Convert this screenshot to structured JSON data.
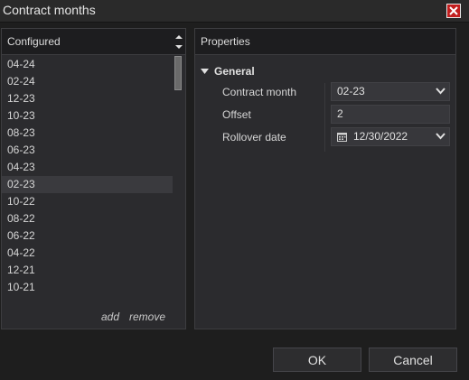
{
  "window": {
    "title": "Contract months",
    "close_icon": "close-icon"
  },
  "left_panel": {
    "header": "Configured",
    "items": [
      "04-24",
      "02-24",
      "12-23",
      "10-23",
      "08-23",
      "06-23",
      "04-23",
      "02-23",
      "10-22",
      "08-22",
      "06-22",
      "04-22",
      "12-21",
      "10-21"
    ],
    "selected": "02-23",
    "add_label": "add",
    "remove_label": "remove"
  },
  "right_panel": {
    "header": "Properties",
    "section": "General",
    "properties": {
      "contract_month": {
        "label": "Contract month",
        "value": "02-23"
      },
      "offset": {
        "label": "Offset",
        "value": "2"
      },
      "rollover_date": {
        "label": "Rollover date",
        "value": "12/30/2022"
      }
    }
  },
  "buttons": {
    "ok": "OK",
    "cancel": "Cancel"
  },
  "colors": {
    "background": "#1e1e1e",
    "panel": "#2b2b2e",
    "close_red": "#c21e1e",
    "selected_row": "#3a3a3e"
  }
}
